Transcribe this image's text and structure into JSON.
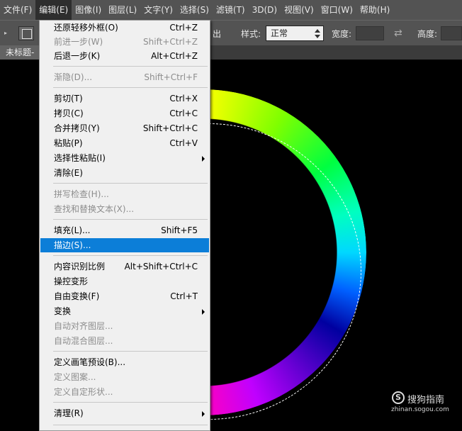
{
  "menubar": {
    "items": [
      "文件(F)",
      "编辑(E)",
      "图像(I)",
      "图层(L)",
      "文字(Y)",
      "选择(S)",
      "滤镜(T)",
      "3D(D)",
      "视图(V)",
      "窗口(W)",
      "帮助(H)"
    ],
    "active_index": 1
  },
  "options": {
    "partial_label": "出",
    "style_label": "样式:",
    "style_value": "正常",
    "width_label": "宽度:",
    "height_label": "高度:"
  },
  "document_tab": {
    "title": "未标题-"
  },
  "edit_menu": {
    "items": [
      {
        "label": "还原轻移外框(O)",
        "shortcut": "Ctrl+Z",
        "enabled": true
      },
      {
        "label": "前进一步(W)",
        "shortcut": "Shift+Ctrl+Z",
        "enabled": false
      },
      {
        "label": "后退一步(K)",
        "shortcut": "Alt+Ctrl+Z",
        "enabled": true
      },
      {
        "label": "渐隐(D)...",
        "shortcut": "Shift+Ctrl+F",
        "enabled": false
      },
      {
        "label": "剪切(T)",
        "shortcut": "Ctrl+X",
        "enabled": true
      },
      {
        "label": "拷贝(C)",
        "shortcut": "Ctrl+C",
        "enabled": true
      },
      {
        "label": "合并拷贝(Y)",
        "shortcut": "Shift+Ctrl+C",
        "enabled": true
      },
      {
        "label": "粘贴(P)",
        "shortcut": "Ctrl+V",
        "enabled": true
      },
      {
        "label": "选择性粘贴(I)",
        "shortcut": "",
        "enabled": true,
        "submenu": true
      },
      {
        "label": "清除(E)",
        "shortcut": "",
        "enabled": true
      },
      {
        "label": "拼写检查(H)...",
        "shortcut": "",
        "enabled": false
      },
      {
        "label": "查找和替换文本(X)...",
        "shortcut": "",
        "enabled": false
      },
      {
        "label": "填充(L)...",
        "shortcut": "Shift+F5",
        "enabled": true
      },
      {
        "label": "描边(S)...",
        "shortcut": "",
        "enabled": true,
        "highlighted": true
      },
      {
        "label": "内容识别比例",
        "shortcut": "Alt+Shift+Ctrl+C",
        "enabled": true
      },
      {
        "label": "操控变形",
        "shortcut": "",
        "enabled": true
      },
      {
        "label": "自由变换(F)",
        "shortcut": "Ctrl+T",
        "enabled": true
      },
      {
        "label": "变换",
        "shortcut": "",
        "enabled": true,
        "submenu": true
      },
      {
        "label": "自动对齐图层...",
        "shortcut": "",
        "enabled": false
      },
      {
        "label": "自动混合图层...",
        "shortcut": "",
        "enabled": false
      },
      {
        "label": "定义画笔预设(B)...",
        "shortcut": "",
        "enabled": true
      },
      {
        "label": "定义图案...",
        "shortcut": "",
        "enabled": false
      },
      {
        "label": "定义自定形状...",
        "shortcut": "",
        "enabled": false
      },
      {
        "label": "清理(R)",
        "shortcut": "",
        "enabled": true,
        "submenu": true
      }
    ]
  },
  "watermark": {
    "logo": "S",
    "name": "搜狗指南",
    "url": "zhinan.sogou.com"
  }
}
